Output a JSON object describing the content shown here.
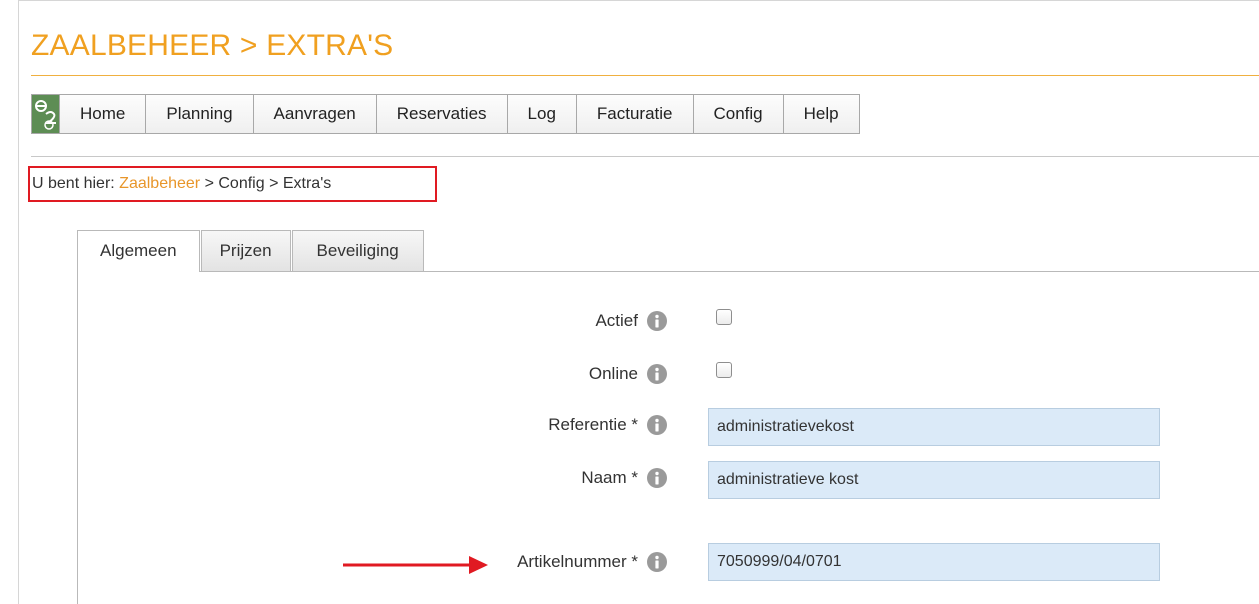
{
  "page": {
    "title": "ZAALBEHEER > EXTRA'S"
  },
  "nav": {
    "logo": {
      "icon": "e2e-logo-icon",
      "color": "#5d8d54"
    },
    "items": [
      {
        "label": "Home"
      },
      {
        "label": "Planning"
      },
      {
        "label": "Aanvragen"
      },
      {
        "label": "Reservaties"
      },
      {
        "label": "Log"
      },
      {
        "label": "Facturatie"
      },
      {
        "label": "Config"
      },
      {
        "label": "Help"
      }
    ]
  },
  "breadcrumb": {
    "prefix": "U bent hier:",
    "link": "Zaalbeheer",
    "rest": "> Config > Extra's",
    "highlight_color": "#e01a22"
  },
  "tabs": [
    {
      "label": "Algemeen",
      "active": true
    },
    {
      "label": "Prijzen",
      "active": false
    },
    {
      "label": "Beveiliging",
      "active": false
    }
  ],
  "form": {
    "actief": {
      "label": "Actief",
      "checked": false
    },
    "online": {
      "label": "Online",
      "checked": false
    },
    "referentie": {
      "label": "Referentie *",
      "value": "administratievekost"
    },
    "naam": {
      "label": "Naam *",
      "value": "administratieve kost"
    },
    "artikelnummer": {
      "label": "Artikelnummer *",
      "value": "7050999/04/0701"
    }
  },
  "colors": {
    "accent": "#f0a020",
    "link": "#e8962a",
    "field_bg": "#dbeaf8",
    "annotation": "#e01a22"
  },
  "icons": {
    "info": "info-circle-icon",
    "arrow": "red-arrow-icon"
  }
}
